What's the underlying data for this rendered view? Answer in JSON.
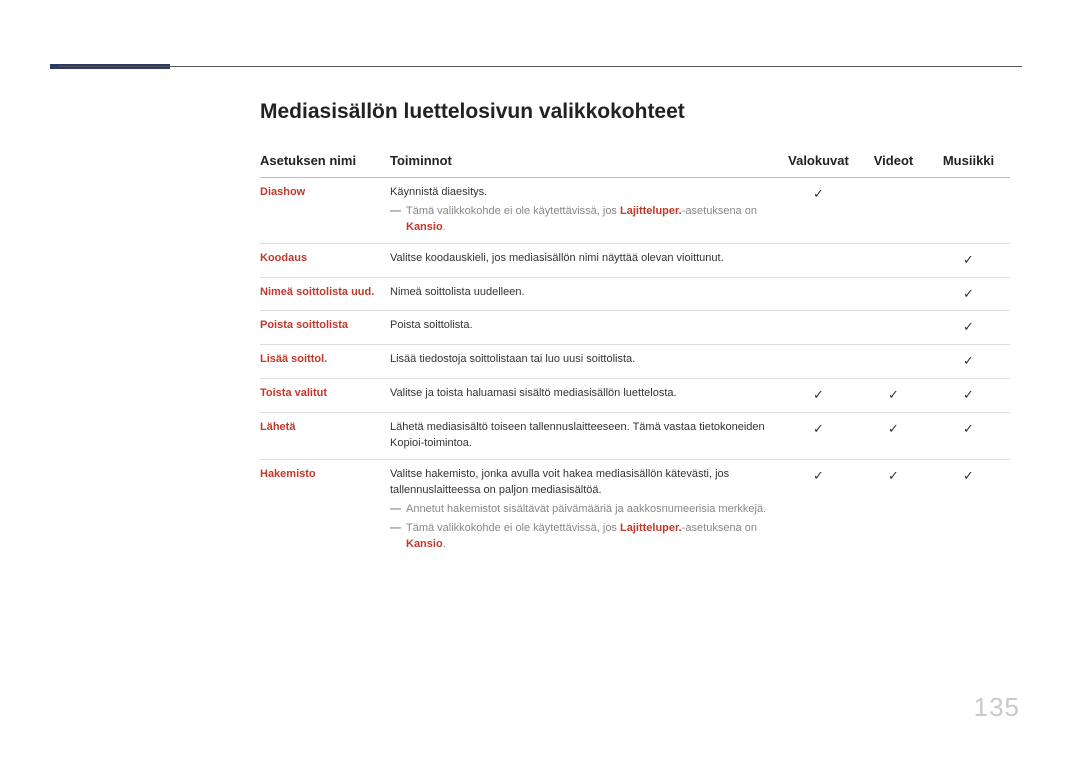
{
  "title": "Mediasisällön luettelosivun valikkokohteet",
  "page_number": "135",
  "headers": {
    "name": "Asetuksen nimi",
    "func": "Toiminnot",
    "photos": "Valokuvat",
    "videos": "Videot",
    "music": "Musiikki"
  },
  "check": "✓",
  "rows": {
    "r0": {
      "name": "Diashow",
      "desc": "Käynnistä diaesitys.",
      "note_prefix": "Tämä valikkokohde ei ole käytettävissä, jos ",
      "note_key1": "Lajitteluper.",
      "note_mid": "-asetuksena on ",
      "note_key2": "Kansio",
      "note_suffix": ".",
      "photos": true,
      "videos": false,
      "music": false
    },
    "r1": {
      "name": "Koodaus",
      "desc": "Valitse koodauskieli, jos mediasisällön nimi näyttää olevan vioittunut.",
      "photos": false,
      "videos": false,
      "music": true
    },
    "r2": {
      "name": "Nimeä soittolista uud.",
      "desc": "Nimeä soittolista uudelleen.",
      "photos": false,
      "videos": false,
      "music": true
    },
    "r3": {
      "name": "Poista soittolista",
      "desc": "Poista soittolista.",
      "photos": false,
      "videos": false,
      "music": true
    },
    "r4": {
      "name": "Lisää soittol.",
      "desc": "Lisää tiedostoja soittolistaan tai luo uusi soittolista.",
      "photos": false,
      "videos": false,
      "music": true
    },
    "r5": {
      "name": "Toista valitut",
      "desc": "Valitse ja toista haluamasi sisältö mediasisällön luettelosta.",
      "photos": true,
      "videos": true,
      "music": true
    },
    "r6": {
      "name": "Lähetä",
      "desc": "Lähetä mediasisältö toiseen tallennuslaitteeseen. Tämä vastaa tietokoneiden Kopioi-toimintoa.",
      "photos": true,
      "videos": true,
      "music": true
    },
    "r7": {
      "name": "Hakemisto",
      "desc": "Valitse hakemisto, jonka avulla voit hakea mediasisällön kätevästi, jos tallennuslaitteessa on paljon mediasisältöä.",
      "note1": "Annetut hakemistot sisältävät päivämääriä ja aakkosnumeerisia merkkejä.",
      "note2_prefix": "Tämä valikkokohde ei ole käytettävissä, jos ",
      "note2_key1": "Lajitteluper.",
      "note2_mid": "-asetuksena on ",
      "note2_key2": "Kansio",
      "note2_suffix": ".",
      "photos": true,
      "videos": true,
      "music": true
    }
  }
}
